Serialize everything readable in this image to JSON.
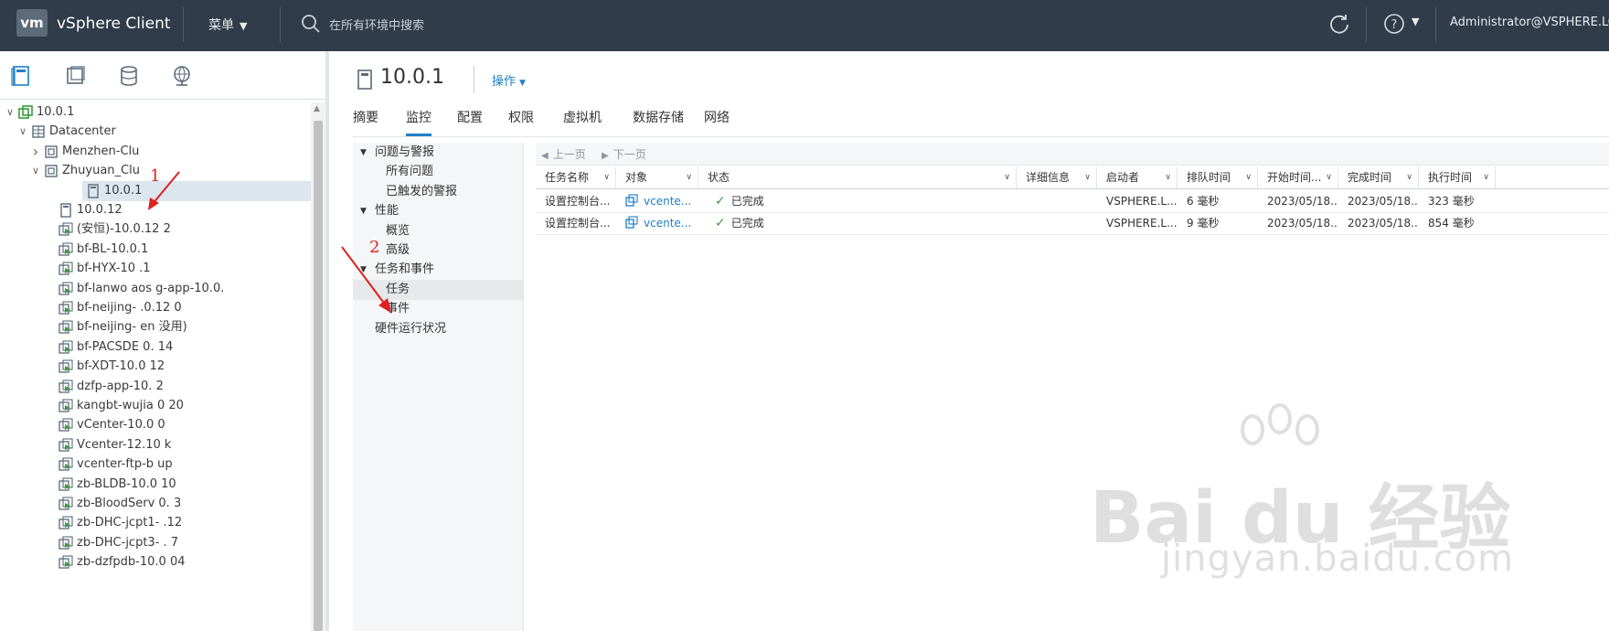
{
  "topbar": {
    "logo": "vm",
    "app_title": "vSphere Client",
    "menu_label": "菜单",
    "search_placeholder": "在所有环境中搜索",
    "user": "Administrator@VSPHERE.LO"
  },
  "left_tree": {
    "items": [
      {
        "label": "10.0.1",
        "level": 0,
        "expanded": true,
        "icon": "vcenter-icon"
      },
      {
        "label": "Datacenter",
        "level": 1,
        "expanded": true,
        "icon": "datacenter-icon"
      },
      {
        "label": "Menzhen-Clu",
        "level": 2,
        "expanded": false,
        "icon": "cluster-icon"
      },
      {
        "label": "Zhuyuan_Clu",
        "level": 2,
        "expanded": true,
        "icon": "cluster-icon"
      },
      {
        "label": "10.0.1",
        "level": 3,
        "icon": "host-icon",
        "selected": true
      },
      {
        "label": "10.0.12",
        "level": 3,
        "icon": "host-icon"
      },
      {
        "label": "(安恒)-10.0.12  2",
        "level": 3,
        "icon": "vm-icon"
      },
      {
        "label": "bf-BL-10.0.1",
        "level": 3,
        "icon": "vm-icon"
      },
      {
        "label": "bf-HYX-10    .1",
        "level": 3,
        "icon": "vm-icon"
      },
      {
        "label": "bf-lanwo    aos   g-app-10.0.",
        "level": 3,
        "icon": "vm-icon"
      },
      {
        "label": "bf-neijing-   .0.12   0",
        "level": 3,
        "icon": "vm-icon"
      },
      {
        "label": "bf-neijing-      en   没用)",
        "level": 3,
        "icon": "vm-icon"
      },
      {
        "label": "bf-PACSDE      0.   14",
        "level": 3,
        "icon": "vm-icon"
      },
      {
        "label": "bf-XDT-10.0   12",
        "level": 3,
        "icon": "vm-icon"
      },
      {
        "label": "dzfp-app-10.     2",
        "level": 3,
        "icon": "vm-icon"
      },
      {
        "label": "kangbt-wujia    0    20",
        "level": 3,
        "icon": "vm-icon"
      },
      {
        "label": "vCenter-10.0    0",
        "level": 3,
        "icon": "vm-icon"
      },
      {
        "label": "Vcenter-12.10    k",
        "level": 3,
        "icon": "vm-icon"
      },
      {
        "label": "vcenter-ftp-b    up",
        "level": 3,
        "icon": "vm-icon"
      },
      {
        "label": "zb-BLDB-10.0    10",
        "level": 3,
        "icon": "vm-icon"
      },
      {
        "label": "zb-BloodServ    0.   3",
        "level": 3,
        "icon": "vm-icon"
      },
      {
        "label": "zb-DHC-jcpt1-    .12",
        "level": 3,
        "icon": "vm-icon"
      },
      {
        "label": "zb-DHC-jcpt3-     .  7",
        "level": 3,
        "icon": "vm-icon"
      },
      {
        "label": "zb-dzfpdb-10.0    04",
        "level": 3,
        "icon": "vm-icon"
      }
    ]
  },
  "object": {
    "title": "10.0.1",
    "actions_label": "操作"
  },
  "tabs": [
    "摘要",
    "监控",
    "配置",
    "权限",
    "虚拟机",
    "数据存储",
    "网络"
  ],
  "monitor_nav": [
    {
      "label": "问题与警报",
      "group": true
    },
    {
      "label": "所有问题",
      "group": false
    },
    {
      "label": "已触发的警报",
      "group": false
    },
    {
      "label": "性能",
      "group": true
    },
    {
      "label": "概览",
      "group": false
    },
    {
      "label": "高级",
      "group": false
    },
    {
      "label": "任务和事件",
      "group": true
    },
    {
      "label": "任务",
      "group": false,
      "selected": true
    },
    {
      "label": "事件",
      "group": false
    },
    {
      "label": "硬件运行状况",
      "group": "leaf"
    }
  ],
  "pager": {
    "prev": "上一页",
    "next": "下一页"
  },
  "task_table": {
    "columns": [
      "任务名称",
      "对象",
      "状态",
      "详细信息",
      "启动者",
      "排队时间",
      "开始时间...",
      "完成时间",
      "执行时间"
    ],
    "rows": [
      {
        "task": "设置控制台...",
        "object": "vcente...",
        "status": "已完成",
        "details": "",
        "initiator": "VSPHERE.L...",
        "queued": "6 毫秒",
        "start": "2023/05/18...",
        "end": "2023/05/18...",
        "duration": "323 毫秒"
      },
      {
        "task": "设置控制台...",
        "object": "vcente...",
        "status": "已完成",
        "details": "",
        "initiator": "VSPHERE.L...",
        "queued": "9 毫秒",
        "start": "2023/05/18...",
        "end": "2023/05/18...",
        "duration": "854 毫秒"
      }
    ]
  },
  "annotations": [
    "1",
    "2"
  ],
  "watermark": {
    "url_text": "jingyan.baidu.com"
  }
}
